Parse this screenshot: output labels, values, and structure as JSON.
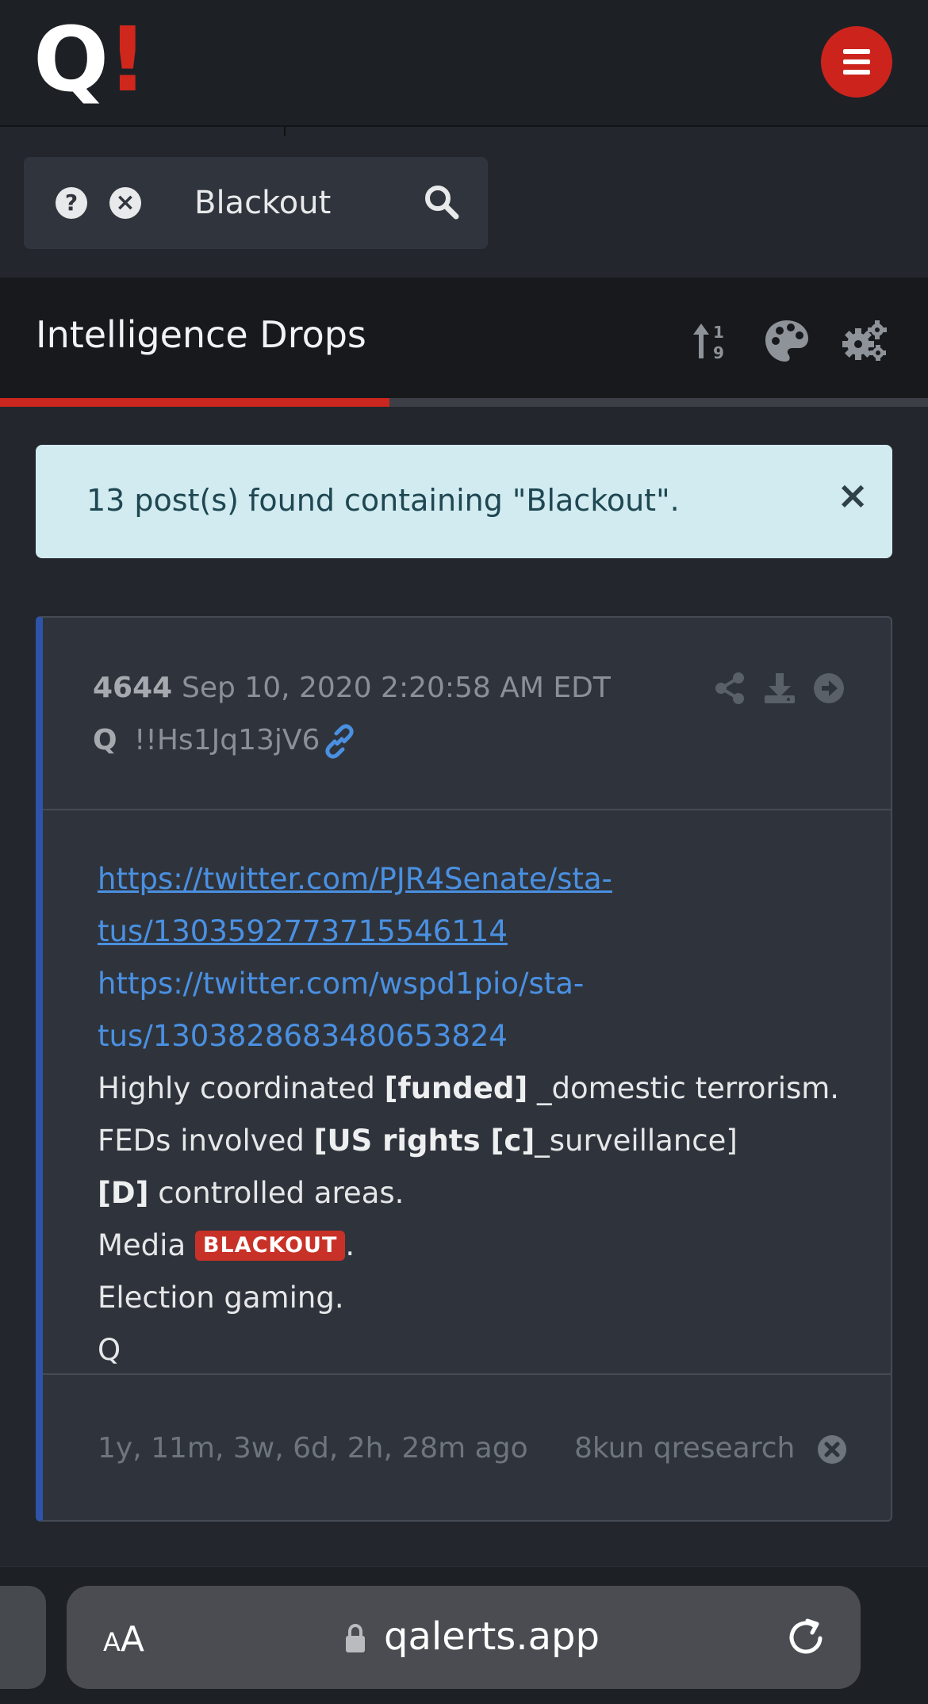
{
  "header": {
    "logo_q": "Q",
    "logo_bang": "!",
    "brand_color": "#cc241c",
    "menu_icon": "hamburger-menu-icon"
  },
  "search": {
    "value": "Blackout",
    "help_icon": "question-circle-icon",
    "clear_icon": "times-circle-icon",
    "search_icon": "search-icon"
  },
  "title_bar": {
    "title": "Intelligence Drops",
    "icons": [
      "sort-numeric-icon",
      "palette-icon",
      "gears-icon"
    ],
    "progress_fraction": 0.42
  },
  "alert": {
    "message": "13 post(s) found containing \"Blackout\".",
    "close_label": "×"
  },
  "post": {
    "id": "4644",
    "date": "Sep 10, 2020 2:20:58 AM EDT",
    "author": "Q",
    "tripcode": "!!Hs1Jq13jV6",
    "accent_color": "#2e53a8",
    "actions": [
      "share-icon",
      "download-icon",
      "arrow-circle-right-icon"
    ],
    "body": {
      "url1_line1": "https://twitter.com/PJR4Senate/sta-",
      "url1_line2": "tus/1303592773715546114",
      "url2_line1": "https://twitter.com/wspd1pio/sta-",
      "url2_line2": "tus/1303828683480653824",
      "line3_a": "Highly coordinated ",
      "line3_b": "[funded]",
      "line3_c": " _domestic terrorism.",
      "line4_a": "FEDs involved ",
      "line4_b": "[US rights [c]",
      "line4_c": "_surveillance]",
      "line5_b": "[D]",
      "line5_c": " controlled areas.",
      "line6_a": "Media ",
      "line6_badge": "BLACKOUT",
      "line6_c": ".",
      "line7": "Election gaming.",
      "line8": "Q"
    },
    "footer": {
      "ago": "1y, 11m, 3w, 6d, 2h, 28m ago",
      "source": "8kun qresearch"
    }
  },
  "browser": {
    "aa_small": "A",
    "aa_large": "A",
    "url": "qalerts.app",
    "lock_icon": "lock-icon",
    "reload_icon": "reload-icon"
  }
}
